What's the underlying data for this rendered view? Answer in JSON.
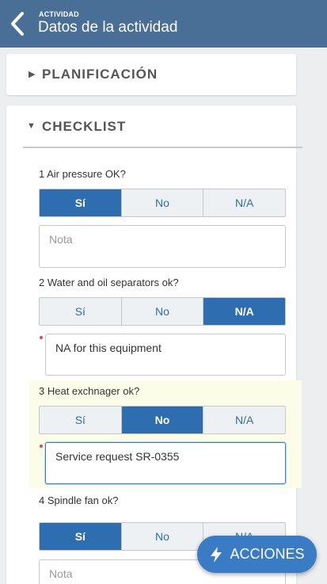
{
  "header": {
    "subtitle": "ACTIVIDAD",
    "title": "Datos de la actividad"
  },
  "sections": {
    "planning": {
      "caret": "▶",
      "label": "PLANIFICACIÓN"
    },
    "checklist": {
      "caret": "▼",
      "label": "CHECKLIST"
    }
  },
  "options": {
    "yes": "Sí",
    "no": "No",
    "na": "N/A"
  },
  "questions": [
    {
      "label": "1 Air pressure OK?",
      "selected": "Sí",
      "note": "",
      "note_placeholder": "Nota"
    },
    {
      "label": "2 Water and oil separators ok?",
      "selected": "N/A",
      "note": "NA for this equipment",
      "required": true
    },
    {
      "label": "3 Heat exchnager ok?",
      "selected": "No",
      "note": "Service request SR-0355",
      "required": true,
      "highlighted": true
    },
    {
      "label": "4 Spindle fan ok?",
      "selected": "Sí",
      "note": "",
      "note_placeholder": "Nota"
    }
  ],
  "fab": {
    "label": "ACCIONES",
    "icon": "lightning-icon"
  },
  "colors": {
    "header": "#4a6f96",
    "accent": "#2f6db1",
    "highlight": "#fcfde8",
    "required": "#e24a4a"
  }
}
